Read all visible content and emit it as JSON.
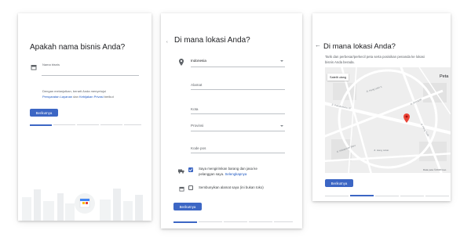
{
  "screen1": {
    "title": "Apakah nama bisnis Anda?",
    "field_label": "Nama bisnis",
    "terms_line1": "Dengan melanjutkan, berarti Anda menyetujui",
    "terms_link1": "Persyaratan Layanan",
    "terms_and": " dan ",
    "terms_link2": "Kebijakan Privasi",
    "terms_end": " berikut",
    "next_label": "Berikutnya"
  },
  "screen2": {
    "title": "Di mana lokasi Anda?",
    "country_value": "Indonesia",
    "address_label": "Alamat",
    "city_label": "Kota",
    "province_label": "Provinsi",
    "postal_label": "Kode pos",
    "delivery_line1": "Saya mengirimkan barang dan jasa ke",
    "delivery_line2_prefix": "pelanggan saya. ",
    "delivery_link": "Selengkapnya",
    "hide_address_label": "Sembunyikan alamat saya (ini bukan toko)",
    "next_label": "Berikutnya"
  },
  "screen3": {
    "title": "Di mana lokasi Anda?",
    "desc_line1": "Tarik dan perbesar/perkecil peta serta posisikan penanda ke lokasi",
    "desc_line2": "bisnis Anda berada.",
    "map_toggle_label": "Satelit ulang",
    "map_corner_label": "Peta",
    "map_attribution": "Data peta ©2018 Goo",
    "street_labels": [
      "Jl. Pakubuwono VI",
      "Jl. Hang Lekir II",
      "Jl. Kebayoran Baru",
      "Jl. Hang Jebat",
      "Jl. Hang Tuah",
      "Jl. Senopati"
    ],
    "next_label": "Berikutnya"
  }
}
